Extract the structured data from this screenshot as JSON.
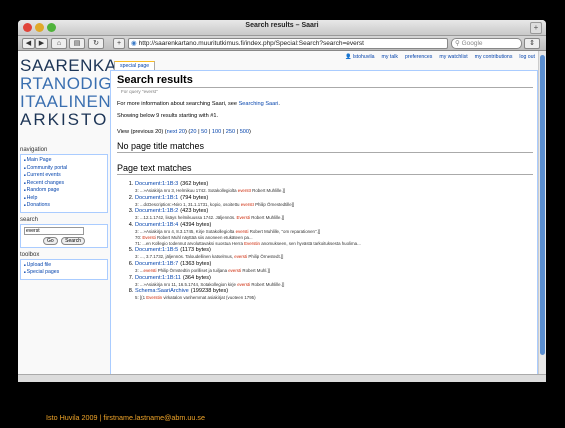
{
  "window": {
    "title": "Search results – Saari",
    "url": "http://saarenkartano.muuritutkimus.fi/index.php/Special:Search?search=everst",
    "search_placeholder": "Google"
  },
  "logo": {
    "line1": "SAARENKA",
    "line2": "RTANODIG",
    "line3": "ITAALINEN",
    "line4": "ARKISTO",
    "colors": {
      "line1": "#1d3556",
      "line2": "#1d3556",
      "line3": "#1d3556",
      "line4": "#1d3556",
      "line2_accent": "#3a6fb0",
      "line3_accent": "#3a6fb0"
    }
  },
  "personal": [
    "Istohuvila",
    "my talk",
    "preferences",
    "my watchlist",
    "my contributions",
    "log out"
  ],
  "tab_label": "special page",
  "sidebar": {
    "navigation_title": "navigation",
    "navigation": [
      "Main Page",
      "Community portal",
      "Current events",
      "Recent changes",
      "Random page",
      "Help",
      "Donations"
    ],
    "search_title": "search",
    "search_value": "everst",
    "go_label": "Go",
    "search_label": "Search",
    "toolbox_title": "toolbox",
    "toolbox": [
      "Upload file",
      "Special pages"
    ]
  },
  "main": {
    "heading": "Search results",
    "subtitle": "For query \"everst\"",
    "info_prefix": "For more information about searching Saari, see ",
    "info_link": "Searching Saari",
    "info_suffix": ".",
    "showing": "Showing below 9 results starting with #1.",
    "view_prefix": "View (previous 20) (",
    "view_next": "next 20",
    "view_mid": ") (",
    "view_counts": [
      "20",
      "50",
      "100",
      "250",
      "500"
    ],
    "view_suffix": ")",
    "no_title": "No page title matches",
    "text_matches": "Page text matches",
    "results": [
      {
        "title": "Document:1:1B:3",
        "size": "(362 bytes)",
        "snippets": [
          [
            "3: ...»Asiakirja nro 3, Helmikuu 1742. Sotakollegiolta ",
            "everstI",
            " Robert Muhlille.]]"
          ]
        ]
      },
      {
        "title": "Document:1:1B:1",
        "size": "(794 bytes)",
        "snippets": [
          [
            "3: ...dcDescription:»Niro 1, 31.1.1731, kopio, osoitettu ",
            "everstI",
            " Philip Örnestedtille]]"
          ]
        ]
      },
      {
        "title": "Document:1:1B:2",
        "size": "(423 bytes)",
        "snippets": [
          [
            "3: ...12.1.1742, lisäys helmikuussa 1742. Jäljennös. ",
            "Eversti",
            " Robert Muhlille.]]"
          ]
        ]
      },
      {
        "title": "Document:1:1B:4",
        "size": "(4394 bytes)",
        "snippets": [
          [
            "3: ...»Asiakirja nro 4, 8.3.1745, Kirje Sotakollegiolta ",
            "eversti",
            " Robert Muhlille, \"om reparationen\".]]"
          ],
          [
            "70: ",
            "Eversti",
            " Robert Muhl näyttää siis anoneen etukäteen pa..."
          ],
          [
            "71: ...en Kollegio todennut arvoluttavaksi suostua Herra ",
            "Everstin",
            " anomukseen, sen hyvästä tarkoituksesta huolima..."
          ]
        ]
      },
      {
        "title": "Document:1:1B:5",
        "size": "(1173 bytes)",
        "snippets": [
          [
            "3: ..., 3.7.1732, jäljennös. Taloudellinen katselmus, ",
            "eversti",
            " Philip Örnestedt.]]"
          ]
        ]
      },
      {
        "title": "Document:1:1B:7",
        "size": "(1363 bytes)",
        "snippets": [
          [
            "3: ...",
            "eversti",
            " Philip Örnstedtin porilliset ja tuiljana ",
            "eversti",
            " Robert Muhl.]]"
          ]
        ]
      },
      {
        "title": "Document:1:1B:11",
        "size": "(364 bytes)",
        "snippets": [
          [
            "3: ...»Asiakirja nro 11, 16.5.1744, Sotakollegion kirje ",
            "eversti",
            " Robert Muhlille.]]"
          ]
        ]
      },
      {
        "title": "Schema:SaariArchive",
        "size": "(199238 bytes)",
        "snippets": [
          [
            "5: [(1 ",
            "Everstin",
            " virkatalon vanhemmat asiakirjat (vuoteen 1795)"
          ]
        ]
      }
    ]
  },
  "footer": "Isto Huvila 2009 | firstname.lastname@abm.uu.se"
}
